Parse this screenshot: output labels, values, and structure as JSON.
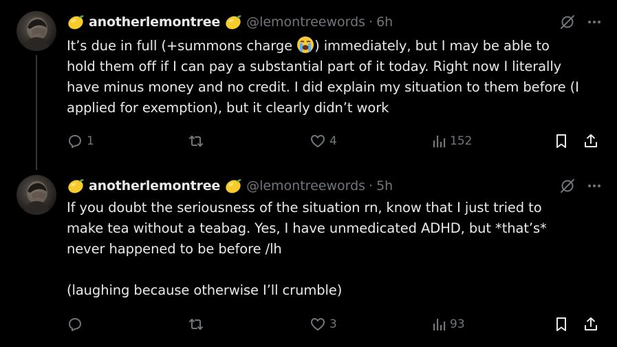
{
  "tweets": [
    {
      "display_name": "anotherlemontree",
      "handle": "@lemontreewords",
      "separator": "·",
      "time": "6h",
      "text_part1": "It’s due in full (+summons charge ",
      "text_part2": ") immediately, but I may be able to\nhold them off if I can pay a substantial part of it today. Right now I literally\nhave minus money and no credit. I did explain my situation to them before (I\napplied for exemption), but it clearly didn’t work",
      "inline_emoji": "loudly-crying-face",
      "replies": "1",
      "reposts": "",
      "likes": "4",
      "views": "152"
    },
    {
      "display_name": "anotherlemontree",
      "handle": "@lemontreewords",
      "separator": "·",
      "time": "5h",
      "text": "If you doubt the seriousness of the situation rn, know that I just tried to\nmake tea without a teabag. Yes, I have unmedicated ADHD, but *that’s*\nnever happened to be before /lh\n\n(laughing because otherwise I’ll crumble)",
      "replies": "",
      "reposts": "",
      "likes": "3",
      "views": "93"
    }
  ],
  "colors": {
    "background": "#000000",
    "primary_text": "#e7e9ea",
    "secondary_text": "#71767b",
    "thread_line": "#333639"
  },
  "icons": {
    "name_emoji": "lemon-emoji",
    "grok": "grok-icon",
    "more": "more-icon",
    "reply": "reply-icon",
    "repost": "repost-icon",
    "like": "heart-icon",
    "views": "views-icon",
    "bookmark": "bookmark-icon",
    "share": "share-icon"
  }
}
